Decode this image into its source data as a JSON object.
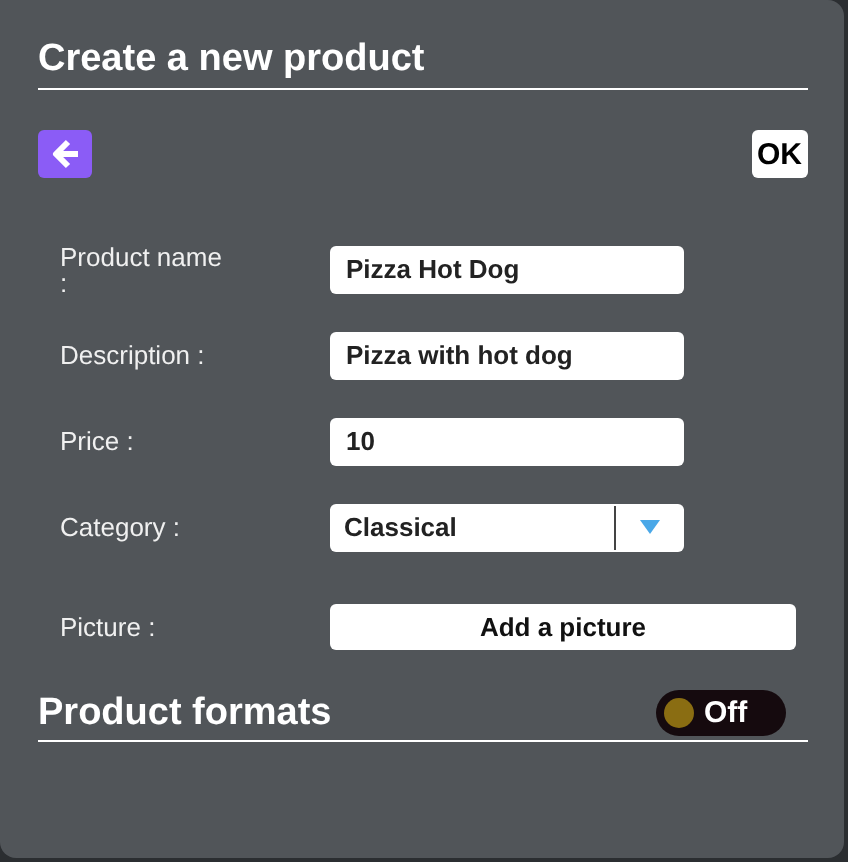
{
  "title": "Create a new product",
  "toolbar": {
    "ok_label": "OK"
  },
  "fields": [
    {
      "kind": "text",
      "label": "Product name :",
      "value": "Pizza Hot Dog"
    },
    {
      "kind": "text",
      "label": "Description :",
      "value": "Pizza with hot dog"
    },
    {
      "kind": "text",
      "label": "Price :",
      "value": "10"
    },
    {
      "kind": "select",
      "label": "Category :",
      "value": "Classical"
    },
    {
      "kind": "button",
      "label": "Picture :",
      "value": "Add a picture"
    }
  ],
  "formats": {
    "title": "Product formats",
    "toggle": {
      "on": false,
      "label": "Off"
    }
  }
}
